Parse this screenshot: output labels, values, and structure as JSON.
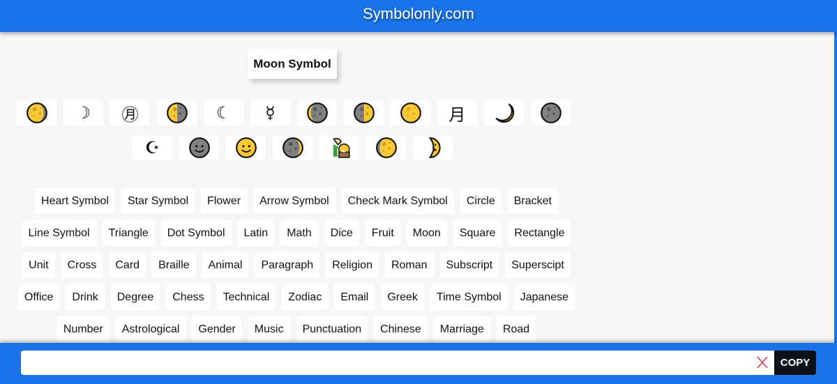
{
  "header": {
    "title": "Symbolonly.com"
  },
  "page": {
    "heading": "Moon Symbol"
  },
  "symbols_row1": [
    {
      "name": "waning-gibbous-moon",
      "kind": "moon",
      "phase": "waning-gibbous"
    },
    {
      "name": "last-quarter-crescent",
      "kind": "text",
      "char": "☽"
    },
    {
      "name": "circled-moon-ideograph",
      "kind": "text",
      "char": "㊊"
    },
    {
      "name": "first-quarter-moon",
      "kind": "moon",
      "phase": "first-quarter"
    },
    {
      "name": "first-quarter-crescent",
      "kind": "text",
      "char": "☾"
    },
    {
      "name": "mercury-like-sign",
      "kind": "text",
      "char": "☿"
    },
    {
      "name": "waning-crescent-moon",
      "kind": "moon",
      "phase": "waning-crescent"
    },
    {
      "name": "last-quarter-moon",
      "kind": "moon",
      "phase": "last-quarter"
    },
    {
      "name": "full-moon",
      "kind": "moon",
      "phase": "full"
    },
    {
      "name": "moon-ideograph",
      "kind": "text",
      "char": "月"
    },
    {
      "name": "crescent-moon",
      "kind": "moon",
      "phase": "crescent"
    },
    {
      "name": "new-moon",
      "kind": "moon",
      "phase": "new"
    }
  ],
  "symbols_row2": [
    {
      "name": "star-and-crescent",
      "kind": "text",
      "char": "☪"
    },
    {
      "name": "new-moon-face",
      "kind": "moon",
      "phase": "new-face"
    },
    {
      "name": "full-moon-face",
      "kind": "moon",
      "phase": "full-face"
    },
    {
      "name": "waxing-crescent-moon",
      "kind": "moon",
      "phase": "waxing-crescent"
    },
    {
      "name": "moon-viewing-ceremony",
      "kind": "moon",
      "phase": "ceremony"
    },
    {
      "name": "waxing-gibbous-moon",
      "kind": "moon",
      "phase": "waxing-gibbous"
    },
    {
      "name": "first-quarter-moon-face",
      "kind": "moon",
      "phase": "quarter-face"
    }
  ],
  "categories": [
    [
      "Heart Symbol",
      "Star Symbol",
      "Flower",
      "Arrow Symbol",
      "Check Mark Symbol",
      "Circle",
      "Bracket"
    ],
    [
      "Line Symbol",
      "Triangle",
      "Dot Symbol",
      "Latin",
      "Math",
      "Dice",
      "Fruit",
      "Moon",
      "Square",
      "Rectangle"
    ],
    [
      "Unit",
      "Cross",
      "Card",
      "Braille",
      "Animal",
      "Paragraph",
      "Religion",
      "Roman",
      "Subscript",
      "Superscipt"
    ],
    [
      "Office",
      "Drink",
      "Degree",
      "Chess",
      "Technical",
      "Zodiac",
      "Email",
      "Greek",
      "Time Symbol",
      "Japanese"
    ],
    [
      "Number",
      "Astrological",
      "Gender",
      "Music",
      "Punctuation",
      "Chinese",
      "Marriage",
      "Road"
    ]
  ],
  "copy_bar": {
    "value": "",
    "placeholder": "",
    "copy_label": "COPY"
  },
  "colors": {
    "brand": "#1a73e8",
    "moon_yellow": "#fcc934",
    "moon_gray": "#808080",
    "copy_button": "#0d1117",
    "clear_x": "#d43c3c"
  }
}
